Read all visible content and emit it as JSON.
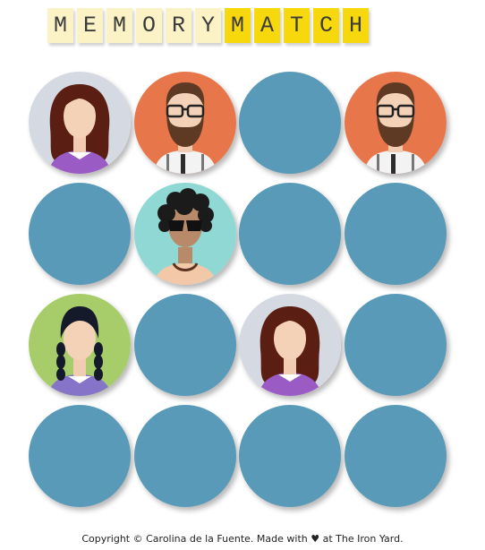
{
  "title": {
    "memory_letters": [
      "M",
      "E",
      "M",
      "O",
      "R",
      "Y"
    ],
    "match_letters": [
      "M",
      "A",
      "T",
      "C",
      "H"
    ]
  },
  "colors": {
    "card_back": "#5a9ab9",
    "memory_tile": "#fbf3c6",
    "match_tile": "#f7d80c"
  },
  "board": {
    "rows": 4,
    "columns": 4,
    "cards": [
      {
        "state": "face-up",
        "avatar": "woman-brown-hair"
      },
      {
        "state": "face-up",
        "avatar": "bearded-man-glasses"
      },
      {
        "state": "face-down",
        "avatar": ""
      },
      {
        "state": "face-up",
        "avatar": "bearded-man-glasses"
      },
      {
        "state": "face-down",
        "avatar": ""
      },
      {
        "state": "face-up",
        "avatar": "curly-hair-sunglasses"
      },
      {
        "state": "face-down",
        "avatar": ""
      },
      {
        "state": "face-down",
        "avatar": ""
      },
      {
        "state": "face-up",
        "avatar": "girl-black-braids"
      },
      {
        "state": "face-down",
        "avatar": ""
      },
      {
        "state": "face-up",
        "avatar": "woman-brown-hair"
      },
      {
        "state": "face-down",
        "avatar": ""
      },
      {
        "state": "face-down",
        "avatar": ""
      },
      {
        "state": "face-down",
        "avatar": ""
      },
      {
        "state": "face-down",
        "avatar": ""
      },
      {
        "state": "face-down",
        "avatar": ""
      }
    ]
  },
  "footer": {
    "text_before": "Copyright © Carolina de la Fuente. Made with",
    "heart_icon": "heart-icon",
    "text_after": "at The Iron Yard."
  }
}
